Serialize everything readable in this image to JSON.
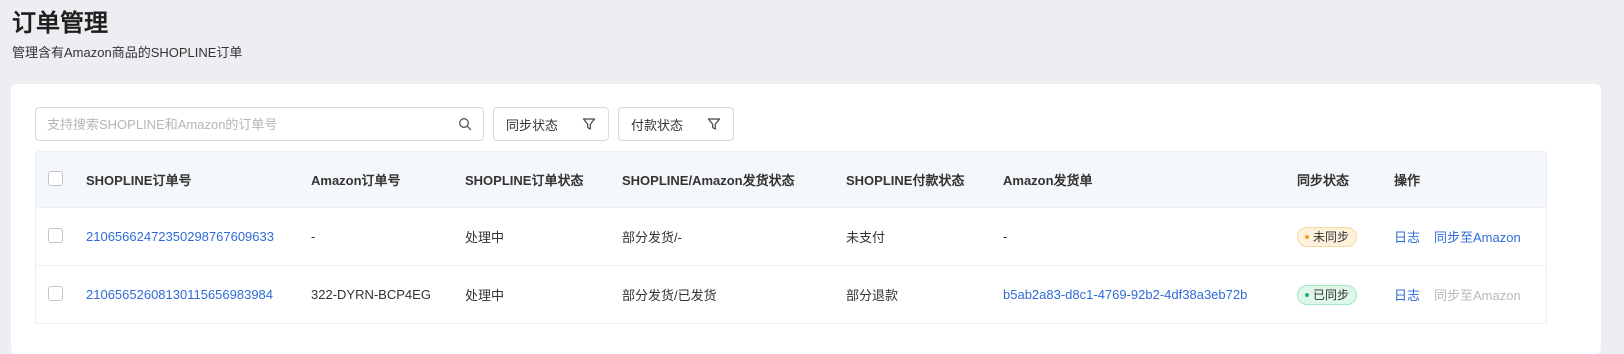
{
  "page": {
    "title": "订单管理",
    "subtitle": "管理含有Amazon商品的SHOPLINE订单"
  },
  "toolbar": {
    "search_placeholder": "支持搜索SHOPLINE和Amazon的订单号",
    "search_value": "",
    "sync_filter_label": "同步状态",
    "pay_filter_label": "付款状态"
  },
  "table": {
    "headers": {
      "shopline_order": "SHOPLINE订单号",
      "amazon_order": "Amazon订单号",
      "shopline_status": "SHOPLINE订单状态",
      "ship_status": "SHOPLINE/Amazon发货状态",
      "pay_status": "SHOPLINE付款状态",
      "amazon_shipment": "Amazon发货单",
      "sync_status": "同步状态",
      "actions": "操作"
    },
    "rows": [
      {
        "shopline_order": "21065662472350298767609633",
        "amazon_order": "-",
        "shopline_status": "处理中",
        "ship_status": "部分发货/-",
        "pay_status": "未支付",
        "amazon_shipment": "-",
        "sync_status": "未同步",
        "action_log": "日志",
        "action_sync": "同步至Amazon"
      },
      {
        "shopline_order": "21065652608130115656983984",
        "amazon_order": "322-DYRN-BCP4EG",
        "shopline_status": "处理中",
        "ship_status": "部分发货/已发货",
        "pay_status": "部分退款",
        "amazon_shipment": "b5ab2a83-d8c1-4769-92b2-4df38a3eb72b",
        "sync_status": "已同步",
        "action_log": "日志",
        "action_sync": "同步至Amazon"
      }
    ]
  },
  "colors": {
    "link": "#2f6bd8",
    "unsynced_badge": "#fdf1dc",
    "synced_badge": "#def7ea"
  }
}
